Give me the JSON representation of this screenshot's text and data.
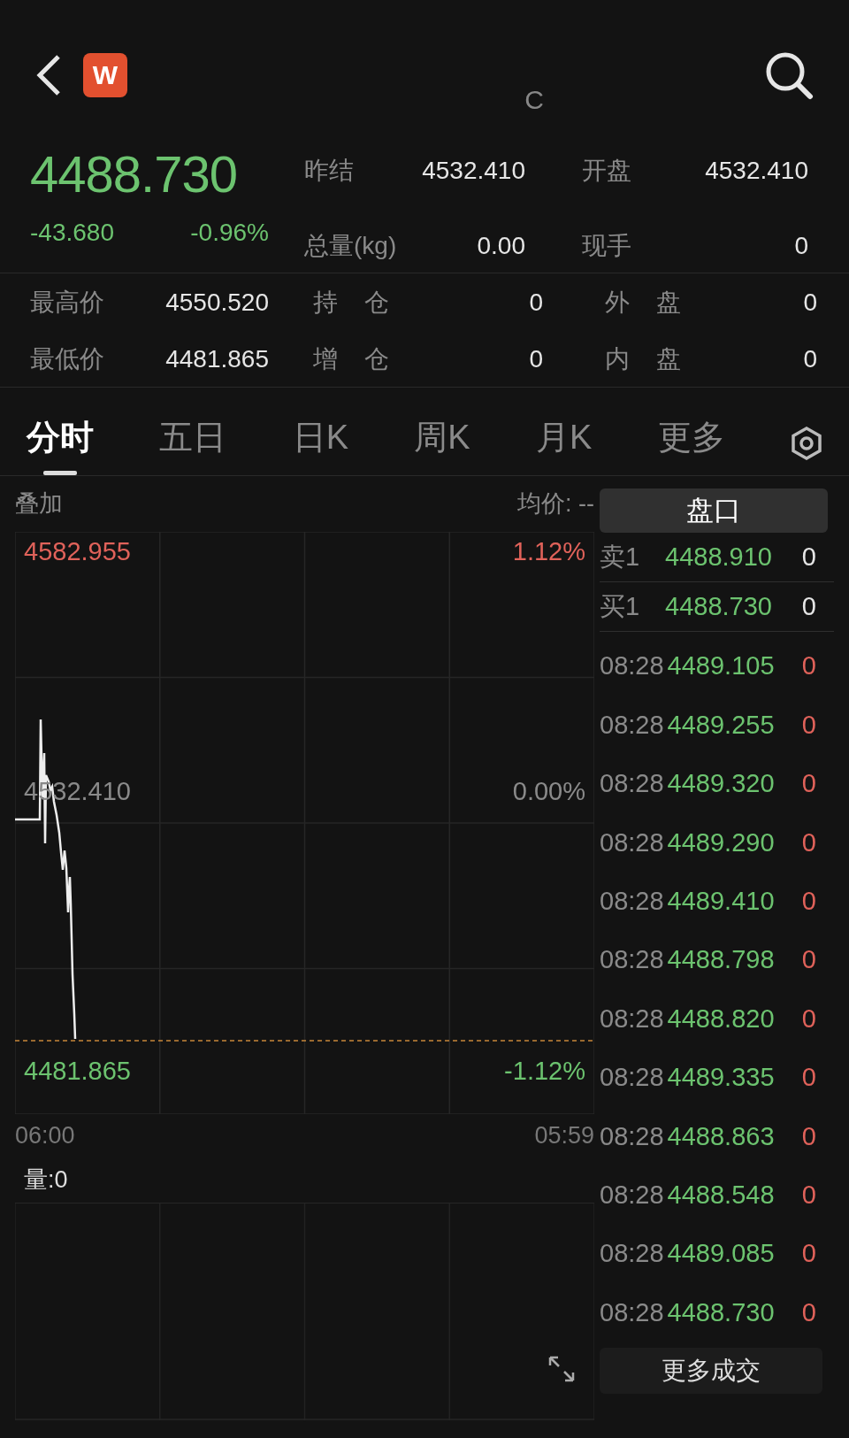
{
  "header": {
    "logo_text": "W",
    "title_fragment": "C"
  },
  "quote": {
    "price": "4488.730",
    "change": "-43.680",
    "change_pct": "-0.96%",
    "color": "#6cc36f"
  },
  "stats_top": [
    {
      "label": "昨结",
      "value": "4532.410"
    },
    {
      "label": "开盘",
      "value": "4532.410"
    },
    {
      "label": "总量(kg)",
      "value": "0.00"
    },
    {
      "label": "现手",
      "value": "0"
    }
  ],
  "stats_bottom": [
    {
      "label": "最高价",
      "value": "4550.520"
    },
    {
      "label": "持 仓",
      "value": "0"
    },
    {
      "label": "外 盘",
      "value": "0"
    },
    {
      "label": "最低价",
      "value": "4481.865"
    },
    {
      "label": "增 仓",
      "value": "0"
    },
    {
      "label": "内 盘",
      "value": "0"
    }
  ],
  "tabs": [
    {
      "label": "分时",
      "selected": true
    },
    {
      "label": "五日",
      "selected": false
    },
    {
      "label": "日K",
      "selected": false
    },
    {
      "label": "周K",
      "selected": false
    },
    {
      "label": "月K",
      "selected": false
    },
    {
      "label": "更多",
      "selected": false
    }
  ],
  "chart": {
    "overlay_label": "叠加",
    "avg_label": "均价: --",
    "price_labels": [
      {
        "text": "4582.955",
        "color": "#e0625a"
      },
      {
        "text": "4532.410",
        "color": "#8a8a8a"
      },
      {
        "text": "4481.865",
        "color": "#6cc36f"
      }
    ],
    "pct_labels": [
      {
        "text": "1.12%",
        "color": "#e0625a"
      },
      {
        "text": "0.00%",
        "color": "#8a8a8a"
      },
      {
        "text": "-1.12%",
        "color": "#6cc36f"
      }
    ],
    "time_start": "06:00",
    "time_end": "05:59"
  },
  "volume": {
    "label": "量:0"
  },
  "order_book": {
    "title": "盘口",
    "quotes": [
      {
        "label": "卖1",
        "price": "4488.910",
        "qty": "0"
      },
      {
        "label": "买1",
        "price": "4488.730",
        "qty": "0"
      }
    ],
    "trades": [
      {
        "time": "08:28",
        "price": "4489.105",
        "qty": "0"
      },
      {
        "time": "08:28",
        "price": "4489.255",
        "qty": "0"
      },
      {
        "time": "08:28",
        "price": "4489.320",
        "qty": "0"
      },
      {
        "time": "08:28",
        "price": "4489.290",
        "qty": "0"
      },
      {
        "time": "08:28",
        "price": "4489.410",
        "qty": "0"
      },
      {
        "time": "08:28",
        "price": "4488.798",
        "qty": "0"
      },
      {
        "time": "08:28",
        "price": "4488.820",
        "qty": "0"
      },
      {
        "time": "08:28",
        "price": "4489.335",
        "qty": "0"
      },
      {
        "time": "08:28",
        "price": "4488.863",
        "qty": "0"
      },
      {
        "time": "08:28",
        "price": "4488.548",
        "qty": "0"
      },
      {
        "time": "08:28",
        "price": "4489.085",
        "qty": "0"
      },
      {
        "time": "08:28",
        "price": "4488.730",
        "qty": "0"
      }
    ],
    "more_button": "更多成交"
  }
}
